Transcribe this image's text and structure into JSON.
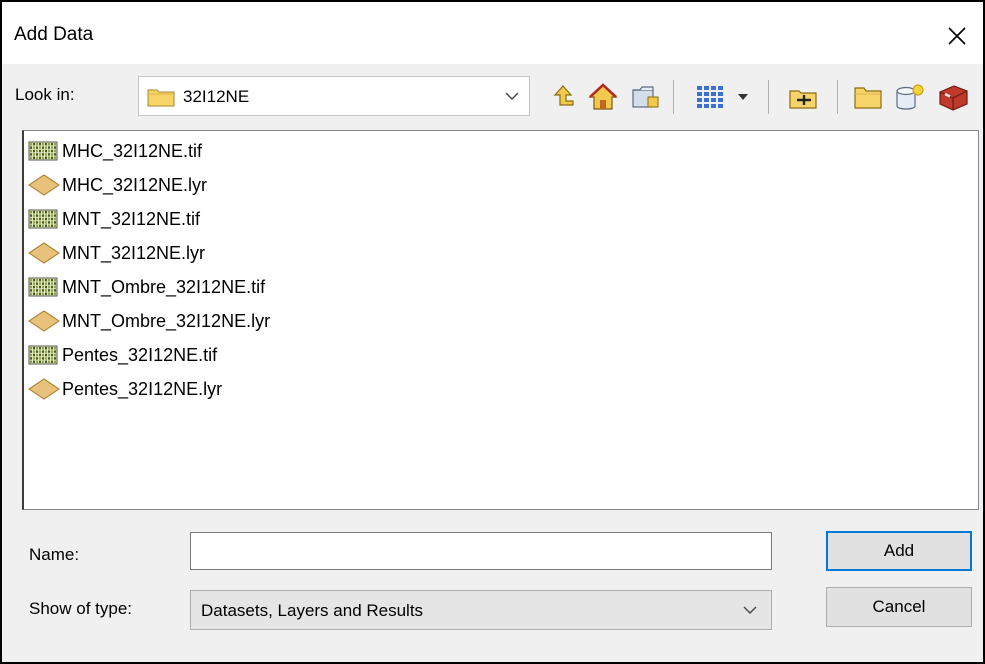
{
  "window": {
    "title": "Add Data",
    "close_icon": "close-icon"
  },
  "lookin": {
    "label": "Look in:",
    "value": "32I12NE",
    "icon": "folder-icon"
  },
  "toolbar": [
    {
      "name": "up-one-level-icon"
    },
    {
      "name": "home-icon"
    },
    {
      "name": "connect-to-folder-icon"
    },
    {
      "name": "list-view-icon"
    },
    {
      "name": "view-dropdown-icon"
    },
    {
      "name": "new-feature-dataset-icon"
    },
    {
      "name": "new-folder-icon"
    },
    {
      "name": "new-geodatabase-icon"
    },
    {
      "name": "toolbox-icon"
    }
  ],
  "files": [
    {
      "label": "MHC_32I12NE.tif",
      "type": "raster"
    },
    {
      "label": "MHC_32I12NE.lyr",
      "type": "layer"
    },
    {
      "label": "MNT_32I12NE.tif",
      "type": "raster"
    },
    {
      "label": "MNT_32I12NE.lyr",
      "type": "layer"
    },
    {
      "label": "MNT_Ombre_32I12NE.tif",
      "type": "raster"
    },
    {
      "label": "MNT_Ombre_32I12NE.lyr",
      "type": "layer"
    },
    {
      "label": "Pentes_32I12NE.tif",
      "type": "raster"
    },
    {
      "label": "Pentes_32I12NE.lyr",
      "type": "layer"
    }
  ],
  "name_field": {
    "label": "Name:",
    "value": ""
  },
  "type_field": {
    "label": "Show of type:",
    "value": "Datasets, Layers and Results"
  },
  "buttons": {
    "add": "Add",
    "cancel": "Cancel"
  },
  "colors": {
    "default_button_border": "#0078d7",
    "folder_yellow": "#f7d46a",
    "layer_tan": "#e8c27a"
  }
}
